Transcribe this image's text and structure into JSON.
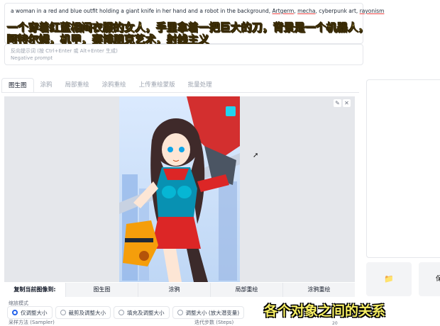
{
  "prompt": {
    "text_before": "a woman in a red and blue outfit holding a giant knife in her hand and a robot in the background, ",
    "link_artgerm": "Artgerm",
    "sep1": ", ",
    "link_mecha": "mecha",
    "mid": ", cyberpunk art, ",
    "link_rayonism": "rayonism"
  },
  "negative": {
    "hint": "反向提示词 (按 Ctrl+Enter 或 Alt+Enter 生成)",
    "placeholder": "Negative prompt"
  },
  "subtitles": {
    "top_line1": "一个穿着红蓝相间衣服的女人，手里拿着一把巨大的刀，背景是一个机器人，",
    "top_line2": "阿特尔姆，机甲，赛博朋克艺术，射线主义",
    "bottom": "各个对象之间的关系"
  },
  "tabs": [
    "图生图",
    "涂鸦",
    "局部重绘",
    "涂鸦重绘",
    "上传重绘蒙版",
    "批量处理"
  ],
  "image_tools": {
    "edit": "✎",
    "close": "✕"
  },
  "copy_row": {
    "label": "复制当前图像到:",
    "buttons": [
      "图生图",
      "涂鸦",
      "局部重绘",
      "涂鸦重绘"
    ]
  },
  "resize": {
    "title": "缩放模式",
    "options": [
      "仅调整大小",
      "裁剪及调整大小",
      "填充及调整大小",
      "调整大小 (放大潜变量)"
    ],
    "selected": "仅调整大小"
  },
  "sampler_label": "采样方法 (Sampler)",
  "steps_label": "迭代步数 (Steps)",
  "steps_value": "20",
  "right": {
    "folder_icon": "📁",
    "btn2_label": "保"
  },
  "colors": {
    "accent": "#2563eb",
    "subtitle": "#f6ee63"
  }
}
